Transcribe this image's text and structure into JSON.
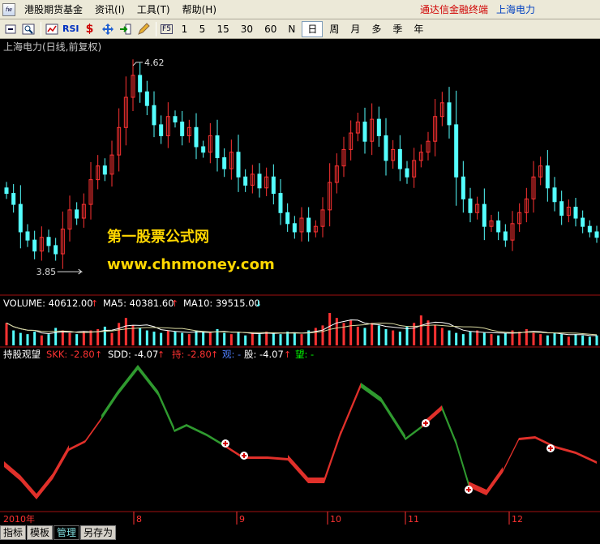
{
  "menu": {
    "items": [
      "港股期货基金",
      "资讯(I)",
      "工具(T)",
      "帮助(H)"
    ],
    "brand": "通达信金融终端",
    "stock": "上海电力"
  },
  "toolbar": {
    "periods": [
      "1",
      "5",
      "15",
      "30",
      "60",
      "N",
      "日",
      "周",
      "月",
      "多",
      "季",
      "年"
    ],
    "selected_period": "日",
    "rsi": "RSI"
  },
  "main": {
    "title": "上海电力(日线,前复权)",
    "high_label": "4.62",
    "low_label": "3.85",
    "watermark1": "第一股票公式网",
    "watermark2": "www.chnmoney.com"
  },
  "volume": {
    "label": "VOLUME: 40612.00",
    "ma5": "MA5: 40381.60",
    "ma10": "MA10: 39515.00"
  },
  "indicator": {
    "name": "持股观望",
    "skk": "SKK: -2.80",
    "sdd": "SDD: -4.07",
    "chi": "持: -2.80",
    "guan": "观: -",
    "gu": "股: -4.07",
    "wang": "望: -"
  },
  "axis": {
    "year": "2010年",
    "months": [
      "8",
      "9",
      "10",
      "11",
      "12"
    ]
  },
  "tabs": {
    "items": [
      "指标",
      "模板",
      "管理",
      "另存为"
    ],
    "selected": "管理"
  },
  "colors": {
    "up": "#ff3232",
    "down": "#54ffff",
    "red_band": "#e0302a",
    "green_band": "#2f9a2f"
  },
  "chart_data": {
    "type": "candlestick",
    "title": "上海电力(日线,前复权)",
    "ymin": 3.85,
    "ymax": 4.62,
    "x_labels": [
      "2010年",
      "8",
      "9",
      "10",
      "11",
      "12"
    ],
    "closes": [
      4.12,
      4.08,
      3.98,
      3.95,
      3.91,
      3.96,
      3.93,
      3.9,
      3.99,
      4.06,
      4.03,
      4.08,
      4.17,
      4.22,
      4.19,
      4.26,
      4.36,
      4.47,
      4.55,
      4.49,
      4.44,
      4.37,
      4.33,
      4.4,
      4.38,
      4.33,
      4.36,
      4.29,
      4.27,
      4.33,
      4.25,
      4.21,
      4.27,
      4.18,
      4.15,
      4.19,
      4.14,
      4.18,
      4.12,
      4.05,
      4.01,
      3.98,
      4.03,
      3.98,
      4.0,
      4.06,
      4.16,
      4.22,
      4.28,
      4.34,
      4.38,
      4.31,
      4.39,
      4.33,
      4.24,
      4.28,
      4.21,
      4.18,
      4.24,
      4.27,
      4.31,
      4.4,
      4.45,
      4.37,
      4.18,
      4.1,
      4.05,
      4.08,
      4.0,
      4.02,
      3.98,
      3.95,
      4.01,
      4.05,
      4.1,
      4.18,
      4.22,
      4.14,
      4.09,
      4.04,
      4.07,
      4.03,
      4.0,
      3.98,
      3.96
    ]
  },
  "volume_data": {
    "type": "bar",
    "values": [
      18,
      12,
      10,
      9,
      11,
      8,
      9,
      14,
      12,
      10,
      9,
      11,
      12,
      13,
      15,
      10,
      18,
      22,
      16,
      14,
      12,
      11,
      10,
      12,
      11,
      10,
      9,
      12,
      11,
      10,
      13,
      10,
      9,
      11,
      8,
      10,
      9,
      11,
      10,
      9,
      11,
      10,
      9,
      12,
      14,
      16,
      26,
      22,
      18,
      20,
      15,
      14,
      18,
      16,
      13,
      12,
      11,
      15,
      18,
      24,
      20,
      16,
      14,
      12,
      10,
      9,
      11,
      12,
      10,
      9,
      8,
      10,
      12,
      11,
      13,
      10,
      9,
      8,
      10,
      9,
      7,
      9,
      8,
      7,
      8
    ]
  }
}
